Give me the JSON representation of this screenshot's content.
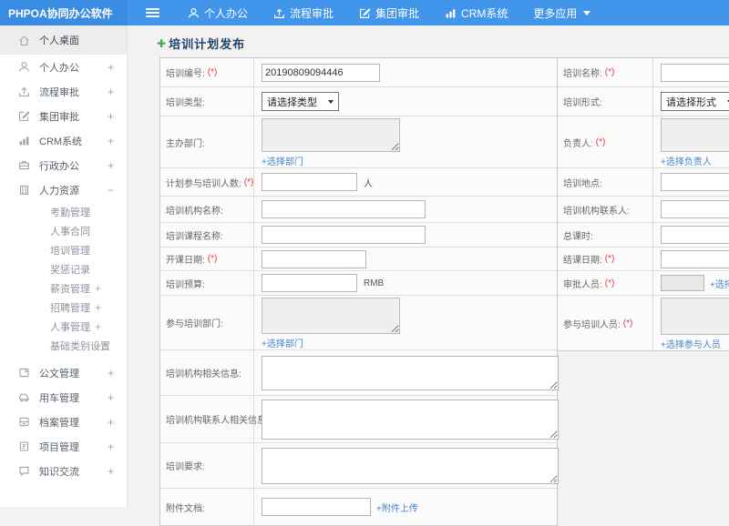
{
  "header": {
    "logo": "PHPOA协同办公软件",
    "nav": [
      {
        "label": "个人办公",
        "icon": "person-icon"
      },
      {
        "label": "流程审批",
        "icon": "workflow-icon"
      },
      {
        "label": "集团审批",
        "icon": "approval-icon"
      },
      {
        "label": "CRM系统",
        "icon": "bar-chart-icon"
      },
      {
        "label": "更多应用",
        "icon": "caret-down-icon"
      }
    ]
  },
  "sidebar": {
    "items": [
      {
        "label": "个人桌面",
        "icon": "home-icon",
        "active": true
      },
      {
        "label": "个人办公",
        "icon": "person-icon",
        "exp": "+"
      },
      {
        "label": "流程审批",
        "icon": "workflow-icon",
        "exp": "+"
      },
      {
        "label": "集团审批",
        "icon": "approval-icon",
        "exp": "+"
      },
      {
        "label": "CRM系统",
        "icon": "bar-chart-icon",
        "exp": "+"
      },
      {
        "label": "行政办公",
        "icon": "briefcase-icon",
        "exp": "+"
      },
      {
        "label": "人力资源",
        "icon": "building-icon",
        "exp": "−"
      },
      {
        "label": "公文管理",
        "icon": "document-icon",
        "exp": "+"
      },
      {
        "label": "用车管理",
        "icon": "car-icon",
        "exp": "+"
      },
      {
        "label": "档案管理",
        "icon": "archive-icon",
        "exp": "+"
      },
      {
        "label": "项目管理",
        "icon": "project-icon",
        "exp": "+"
      },
      {
        "label": "知识交流",
        "icon": "chat-icon",
        "exp": "+"
      }
    ],
    "hr_children": [
      {
        "label": "考勤管理"
      },
      {
        "label": "人事合同"
      },
      {
        "label": "培训管理"
      },
      {
        "label": "奖惩记录"
      },
      {
        "label": "薪资管理",
        "exp": "+"
      },
      {
        "label": "招聘管理",
        "exp": "+"
      },
      {
        "label": "人事管理",
        "exp": "+"
      },
      {
        "label": "基础类别设置",
        "exp": "+"
      }
    ]
  },
  "form": {
    "title": "培训计划发布",
    "plus_icon": "✚",
    "fields": {
      "no": {
        "label": "培训编号:",
        "req": "(*)",
        "value": "20190809094446"
      },
      "name": {
        "label": "培训名称:",
        "req": "(*)"
      },
      "type": {
        "label": "培训类型:",
        "selected": "请选择类型"
      },
      "mode": {
        "label": "培训形式:",
        "selected": "请选择形式"
      },
      "dept": {
        "label": "主办部门:",
        "link": "+选择部门"
      },
      "leader": {
        "label": "负责人:",
        "req": "(*)",
        "link": "+选择负责人"
      },
      "count": {
        "label": "计划参与培训人数:",
        "req": "(*)",
        "unit": "人"
      },
      "place": {
        "label": "培训地点:"
      },
      "org": {
        "label": "培训机构名称:"
      },
      "orgcontact": {
        "label": "培训机构联系人:"
      },
      "course": {
        "label": "培训课程名称:"
      },
      "hours": {
        "label": "总课时:"
      },
      "startdate": {
        "label": "开课日期:",
        "req": "(*)"
      },
      "enddate": {
        "label": "结课日期:",
        "req": "(*)"
      },
      "budget": {
        "label": "培训预算:",
        "unit": "RMB"
      },
      "approver": {
        "label": "审批人员:",
        "req": "(*)",
        "link": "+选择审批人员"
      },
      "joindept": {
        "label": "参与培训部门:",
        "link": "+选择部门"
      },
      "joinppl": {
        "label": "参与培训人员:",
        "req": "(*)",
        "link": "+选择参与人员"
      },
      "orginfo": {
        "label": "培训机构相关信息:"
      },
      "contactinfo": {
        "label": "培训机构联系人相关信息:"
      },
      "require": {
        "label": "培训要求:"
      },
      "attach": {
        "label": "附件文档:",
        "link": "+附件上传"
      }
    }
  },
  "colors": {
    "header_bg": "#4196ec",
    "logo_bg": "#3a8ce2",
    "link_blue": "#4285ca",
    "required_red": "#e23b3b",
    "title_navy": "#20456b",
    "plus_green": "#3fae49"
  }
}
